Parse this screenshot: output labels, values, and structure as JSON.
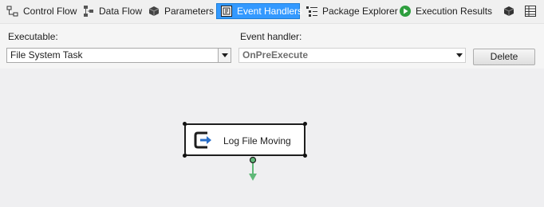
{
  "tabs": [
    {
      "label": "Control Flow",
      "icon": "control-flow-icon"
    },
    {
      "label": "Data Flow",
      "icon": "data-flow-icon"
    },
    {
      "label": "Parameters",
      "icon": "parameters-icon"
    },
    {
      "label": "Event Handlers",
      "icon": "event-handlers-icon",
      "active": true
    },
    {
      "label": "Package Explorer",
      "icon": "package-explorer-icon"
    },
    {
      "label": "Execution Results",
      "icon": "execution-results-icon"
    }
  ],
  "toolbar_icons": [
    "variables-icon",
    "grid-icon"
  ],
  "executable": {
    "label": "Executable:",
    "value": "File System Task"
  },
  "event_handler": {
    "label": "Event handler:",
    "value": "OnPreExecute"
  },
  "delete_label": "Delete",
  "task": {
    "label": "Log File Moving",
    "icon": "execute-sql-task-icon"
  },
  "colors": {
    "accent": "#3399ff",
    "constraint": "#5fb878"
  }
}
